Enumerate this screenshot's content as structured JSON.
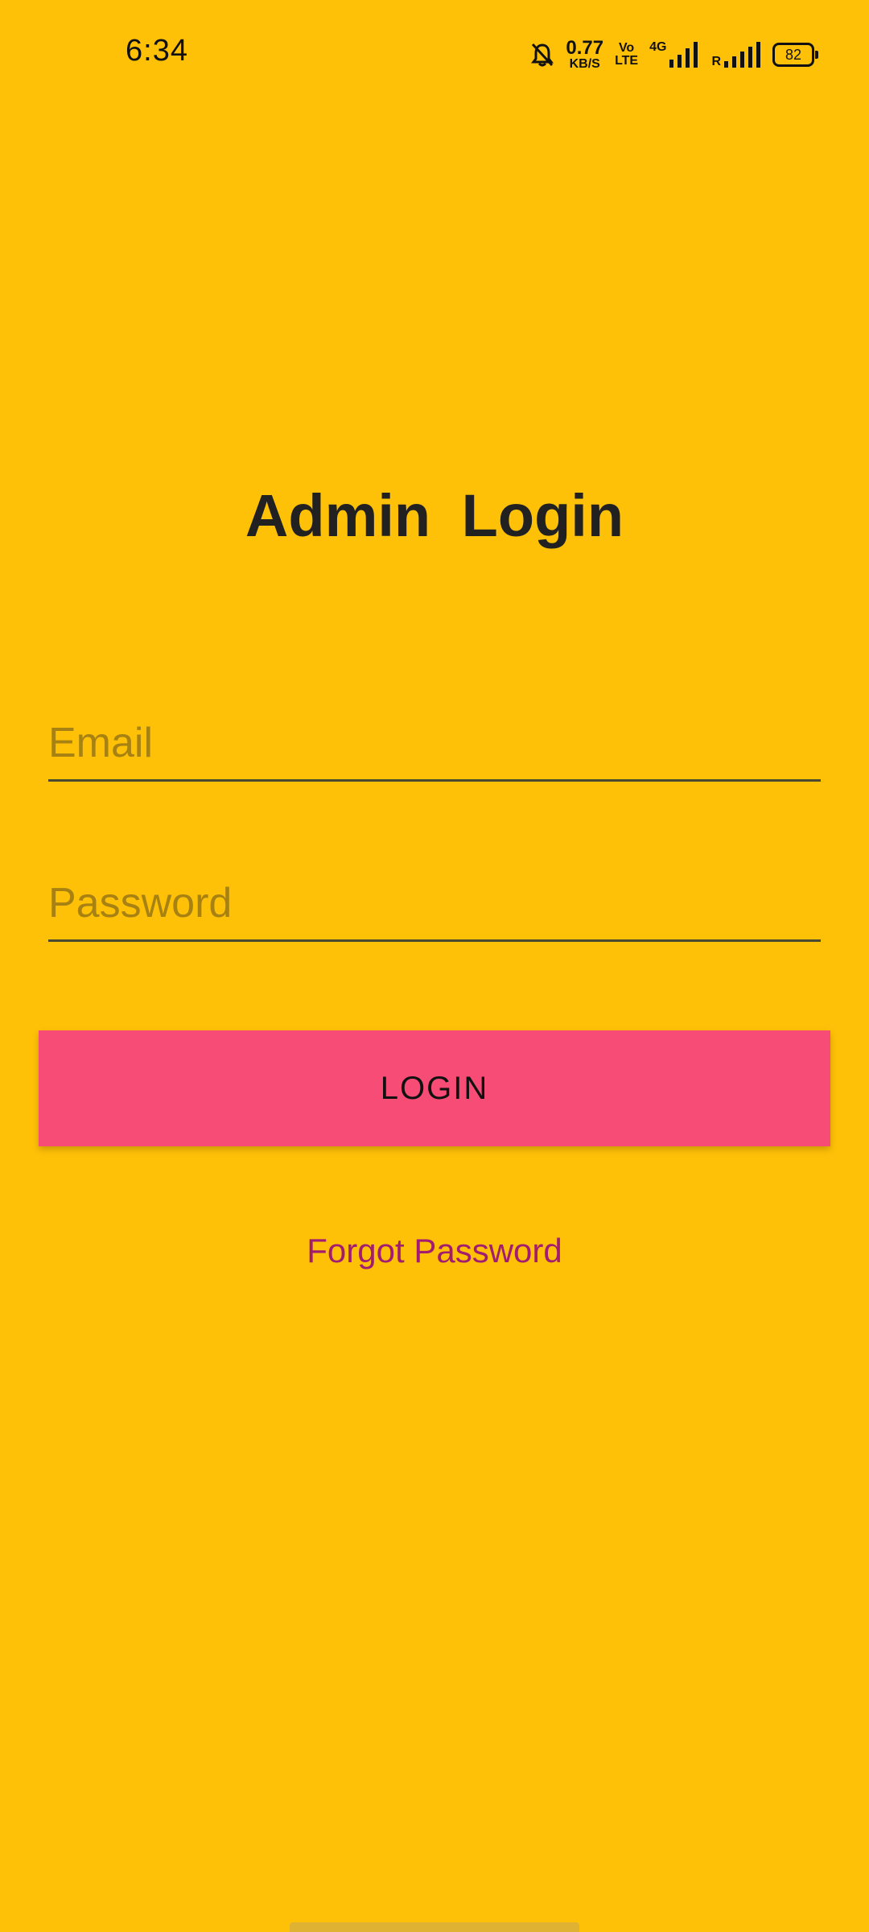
{
  "status_bar": {
    "time": "6:34",
    "net_speed_value": "0.77",
    "net_speed_unit": "KB/S",
    "volte_top": "Vo",
    "volte_bottom": "LTE",
    "network_type": "4G",
    "roaming_label": "R",
    "battery_level": "82"
  },
  "title": "Admin Login",
  "form": {
    "email_placeholder": "Email",
    "password_placeholder": "Password",
    "login_label": "LOGIN",
    "forgot_password_label": "Forgot Password"
  },
  "colors": {
    "background": "#FFC107",
    "login_button": "#F74C75",
    "forgot_link": "#A21C70"
  }
}
